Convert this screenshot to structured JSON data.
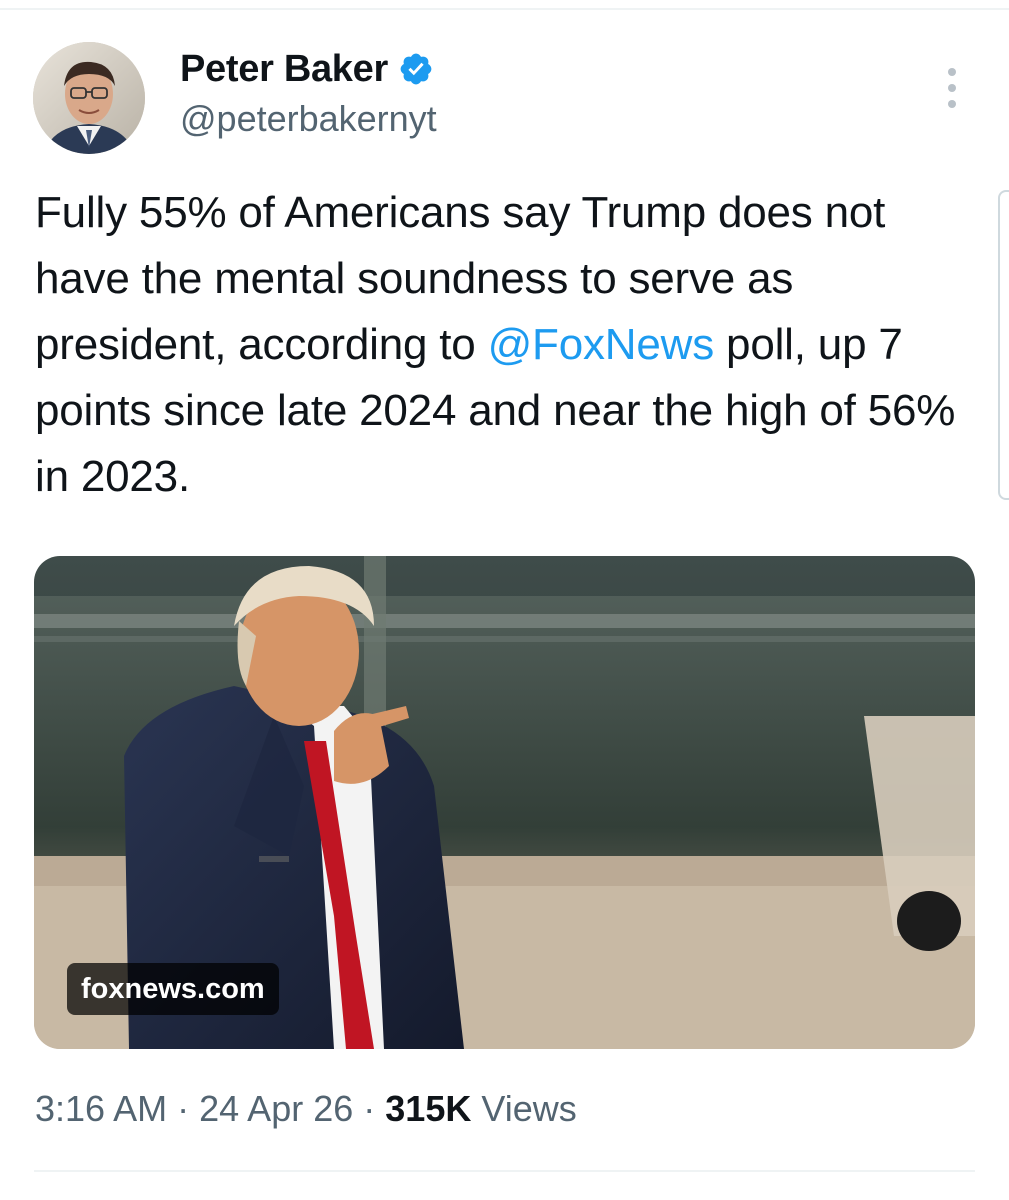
{
  "author": {
    "name": "Peter Baker",
    "handle": "@peterbakernyt",
    "avatar_icon": "author-avatar",
    "verified_icon": "verified-badge-icon",
    "verified_color": "#1d9bf0"
  },
  "tweet": {
    "text_before": "Fully 55% of Americans say Trump does not have the mental soundness to serve as president, according to ",
    "mention": "@FoxNews",
    "text_after": " poll, up 7 points since late 2024 and near the high of 56% in 2023.",
    "mention_color": "#1d9bf0"
  },
  "link_card": {
    "domain": "foxnews.com",
    "image_icon": "news-photo"
  },
  "meta": {
    "time": "3:16 AM",
    "separator": "·",
    "date": "24 Apr 26",
    "views_count": "315K",
    "views_label": "Views"
  },
  "menu": {
    "icon": "more-options-icon"
  }
}
